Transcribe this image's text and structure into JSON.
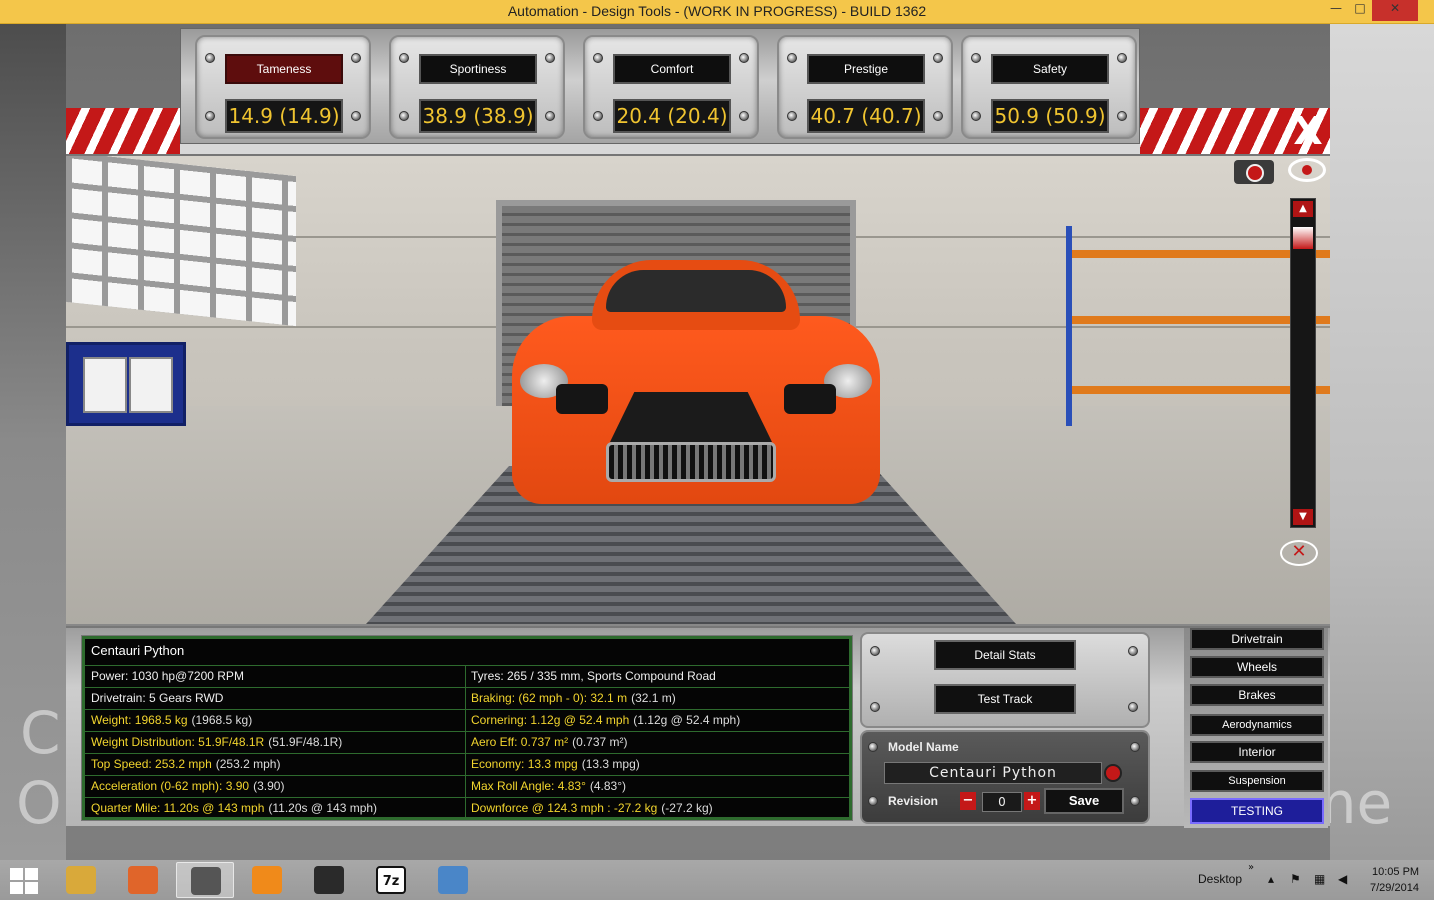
{
  "window": {
    "title": "Automation - Design Tools - (WORK IN PROGRESS) - BUILD 1362",
    "minimize": "—",
    "maximize": "□",
    "close": "✕"
  },
  "desktop_text": {
    "c": "C",
    "o": "O",
    "me": "me"
  },
  "stats": [
    {
      "label": "Tameness",
      "value": "14.9 (14.9)",
      "active": true
    },
    {
      "label": "Sportiness",
      "value": "38.9 (38.9)"
    },
    {
      "label": "Comfort",
      "value": "20.4 (20.4)"
    },
    {
      "label": "Prestige",
      "value": "40.7 (40.7)"
    },
    {
      "label": "Safety",
      "value": "50.9 (50.9)"
    }
  ],
  "close_label": "X",
  "scene": {
    "hide_icon": "✕",
    "scroll_up": "▲",
    "scroll_down": "▼"
  },
  "car": {
    "name": "Centauri Python",
    "specs": [
      {
        "left": {
          "key": "Power: 1030 hp@7200 RPM",
          "val": "",
          "color": "white"
        },
        "right": {
          "key": "Tyres: 265 / 335 mm, Sports Compound Road",
          "val": "",
          "color": "white"
        }
      },
      {
        "left": {
          "key": "Drivetrain: 5 Gears RWD",
          "val": "",
          "color": "white"
        },
        "right": {
          "key": "Braking: (62 mph - 0): 32.1 m",
          "val": "(32.1 m)",
          "color": "yellow"
        }
      },
      {
        "left": {
          "key": "Weight: 1968.5 kg",
          "val": "(1968.5 kg)",
          "color": "yellow"
        },
        "right": {
          "key": "Cornering: 1.12g @ 52.4 mph",
          "val": "(1.12g @ 52.4 mph)",
          "color": "yellow"
        }
      },
      {
        "left": {
          "key": "Weight Distribution: 51.9F/48.1R",
          "val": "(51.9F/48.1R)",
          "color": "yellow"
        },
        "right": {
          "key": "Aero Eff: 0.737 m²",
          "val": "(0.737 m²)",
          "color": "yellow"
        }
      },
      {
        "left": {
          "key": "Top Speed: 253.2 mph",
          "val": "(253.2 mph)",
          "color": "yellow"
        },
        "right": {
          "key": "Economy: 13.3 mpg",
          "val": "(13.3 mpg)",
          "color": "yellow"
        }
      },
      {
        "left": {
          "key": "Acceleration (0-62 mph): 3.90",
          "val": "(3.90)",
          "color": "yellow"
        },
        "right": {
          "key": "Max Roll Angle: 4.83°",
          "val": "(4.83°)",
          "color": "yellow"
        }
      },
      {
        "left": {
          "key": "Quarter Mile: 11.20s @ 143 mph",
          "val": "(11.20s @ 143 mph)",
          "color": "yellow"
        },
        "right": {
          "key": "Downforce @ 124.3 mph : -27.2 kg",
          "val": "(-27.2 kg)",
          "color": "yellow"
        }
      }
    ]
  },
  "actions": {
    "detail_stats": "Detail Stats",
    "test_track": "Test Track"
  },
  "model": {
    "label": "Model Name",
    "name_value": "Centauri Python",
    "revision_label": "Revision",
    "revision_minus": "−",
    "revision_value": "0",
    "revision_plus": "+",
    "save": "Save"
  },
  "tabs": [
    "Drivetrain",
    "Wheels",
    "Brakes",
    "Aerodynamics",
    "Interior",
    "Suspension",
    "TESTING"
  ],
  "taskbar": {
    "apps": [
      {
        "name": "file-explorer-icon",
        "glyph": "",
        "color": "#d9a93a"
      },
      {
        "name": "firefox-icon",
        "glyph": "",
        "color": "#e0652a"
      },
      {
        "name": "automation-app-icon",
        "glyph": "",
        "color": "#555555",
        "active": true
      },
      {
        "name": "vlc-icon",
        "glyph": "",
        "color": "#f08a1a"
      },
      {
        "name": "steam-icon",
        "glyph": "",
        "color": "#2a2a2a"
      },
      {
        "name": "7zip-icon",
        "glyph": "7z",
        "color": "#111111"
      },
      {
        "name": "paint-icon",
        "glyph": "",
        "color": "#4a86c8"
      }
    ],
    "desktop_label": "Desktop",
    "chevron": "»",
    "time": "10:05 PM",
    "date": "7/29/2014"
  },
  "colors": {
    "accent_red": "#c41818",
    "value_yellow": "#f0c430",
    "active_tab": "#1e1e9a",
    "titlebar": "#f4c64a"
  }
}
